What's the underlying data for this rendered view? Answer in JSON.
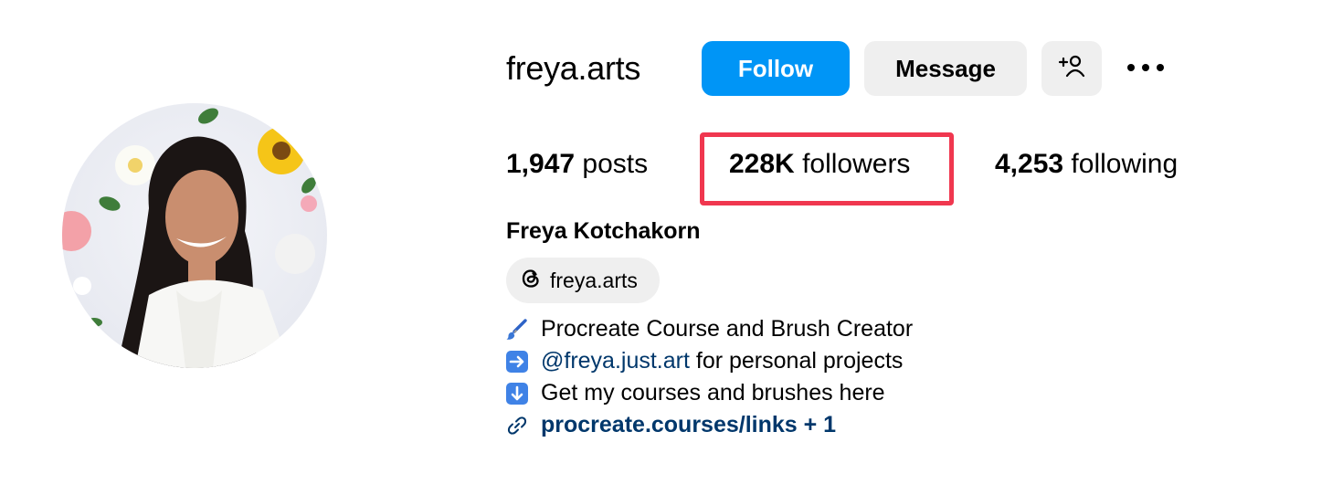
{
  "profile": {
    "username": "freya.arts",
    "full_name": "Freya Kotchakorn"
  },
  "actions": {
    "follow_label": "Follow",
    "message_label": "Message",
    "add_user_icon": "person-plus-icon",
    "more_icon": "more-horizontal-icon"
  },
  "stats": {
    "posts_count": "1,947",
    "posts_label": "posts",
    "followers_count": "228K",
    "followers_label": "followers",
    "following_count": "4,253",
    "following_label": "following"
  },
  "threads": {
    "handle": "freya.arts",
    "icon": "threads-icon"
  },
  "bio": {
    "line1_icon": "paintbrush-emoji",
    "line1_text": "Procreate Course and Brush Creator",
    "line2_icon": "right-arrow-emoji",
    "line2_mention": "@freya.just.art",
    "line2_text": " for personal projects",
    "line3_icon": "down-arrow-emoji",
    "line3_text": "Get my courses and brushes here",
    "link_icon": "link-icon",
    "link_text": "procreate.courses/links + 1"
  },
  "colors": {
    "follow_button": "#0095f6",
    "secondary_button": "#efefef",
    "highlight_box": "#f0374f",
    "link": "#00376b"
  }
}
